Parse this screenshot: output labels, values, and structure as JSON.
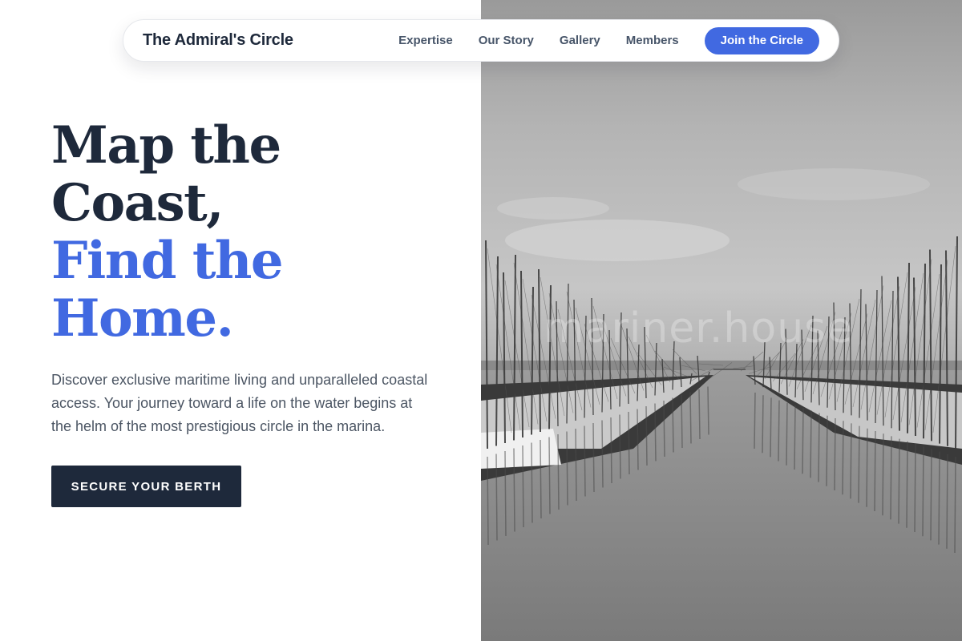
{
  "nav": {
    "brand": "The Admiral's Circle",
    "links": [
      "Expertise",
      "Our Story",
      "Gallery",
      "Members"
    ],
    "cta_label": "Join the Circle"
  },
  "hero": {
    "headline": {
      "line1": "Map the",
      "line2": "Coast,",
      "line3": "Find the",
      "line4": "Home."
    },
    "description": "Discover exclusive maritime living and unparalleled coastal access. Your journey toward a life on the water begins at the helm of the most prestigious circle in the marina.",
    "cta_label": "SECURE YOUR BERTH"
  },
  "image": {
    "subject": "black-and-white marina photo",
    "watermark": "mariner.house"
  },
  "colors": {
    "accent": "#4169e1",
    "navy": "#1e293b",
    "body_text": "#4b5563",
    "nav_text": "#475569"
  }
}
